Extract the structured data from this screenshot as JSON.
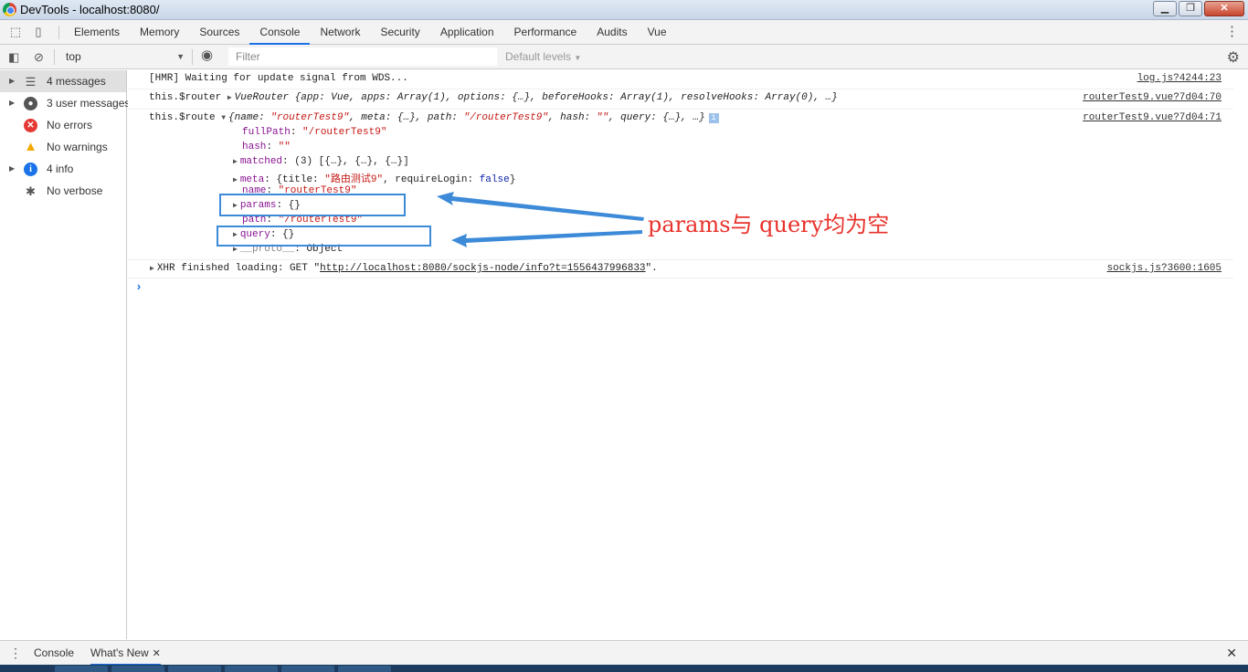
{
  "window": {
    "title": "DevTools - localhost:8080/",
    "controls": [
      "minimize",
      "restore",
      "close"
    ]
  },
  "tabs": [
    "Elements",
    "Memory",
    "Sources",
    "Console",
    "Network",
    "Security",
    "Application",
    "Performance",
    "Audits",
    "Vue"
  ],
  "active_tab": "Console",
  "toolbar": {
    "context": "top",
    "filter_placeholder": "Filter",
    "levels": "Default levels"
  },
  "sidebar": {
    "items": [
      {
        "label": "4 messages",
        "icon": "list-icon",
        "expandable": true,
        "selected": true
      },
      {
        "label": "3 user messages",
        "icon": "user-icon",
        "expandable": true
      },
      {
        "label": "No errors",
        "icon": "error-icon",
        "expandable": false
      },
      {
        "label": "No warnings",
        "icon": "warning-icon",
        "expandable": false
      },
      {
        "label": "4 info",
        "icon": "info-icon",
        "expandable": true
      },
      {
        "label": "No verbose",
        "icon": "bug-icon",
        "expandable": false
      }
    ]
  },
  "console": {
    "hmr": {
      "text": "[HMR] Waiting for update signal from WDS...",
      "source": "log.js?4244:23"
    },
    "router": {
      "label": "this.$router",
      "summary": "VueRouter {app: Vue, apps: Array(1), options: {…}, beforeHooks: Array(1), resolveHooks: Array(0), …}",
      "source": "routerTest9.vue?7d04:70"
    },
    "route": {
      "label": "this.$route",
      "summary_prefix": "{name: ",
      "summary_name": "\"routerTest9\"",
      "summary_mid": ", meta: {…}, path: ",
      "summary_path": "\"/routerTest9\"",
      "summary_mid2": ", hash: ",
      "summary_hash": "\"\"",
      "summary_end": ", query: {…}, …}",
      "source": "routerTest9.vue?7d04:71",
      "props": {
        "fullPath_key": "fullPath",
        "fullPath_val": "\"/routerTest9\"",
        "hash_key": "hash",
        "hash_val": "\"\"",
        "matched_key": "matched",
        "matched_val": "(3) [{…}, {…}, {…}]",
        "meta_key": "meta",
        "meta_val_a": "{title: ",
        "meta_title": "\"路由测试9\"",
        "meta_val_b": ", requireLogin: ",
        "meta_login": "false",
        "meta_val_c": "}",
        "name_key": "name",
        "name_val": "\"routerTest9\"",
        "params_key": "params",
        "params_val": "{}",
        "path_key": "path",
        "path_val": "\"/routerTest9\"",
        "query_key": "query",
        "query_val": "{}",
        "proto_key": "__proto__",
        "proto_val": "Object"
      }
    },
    "xhr": {
      "prefix": "XHR finished loading: GET \"",
      "url": "http://localhost:8080/sockjs-node/info?t=1556437996833",
      "suffix": "\".",
      "source": "sockjs.js?3600:1605"
    },
    "prompt": "›"
  },
  "annotation": {
    "text": "params与 query均为空",
    "color": "#e8322b",
    "box_color": "#3c8ad8"
  },
  "drawer": {
    "tabs": [
      "Console",
      "What's New"
    ],
    "active": "What's New"
  },
  "colors": {
    "accent": "#1a73e8",
    "string": "#c41a16",
    "key": "#881391",
    "keyword": "#0d22aa"
  }
}
